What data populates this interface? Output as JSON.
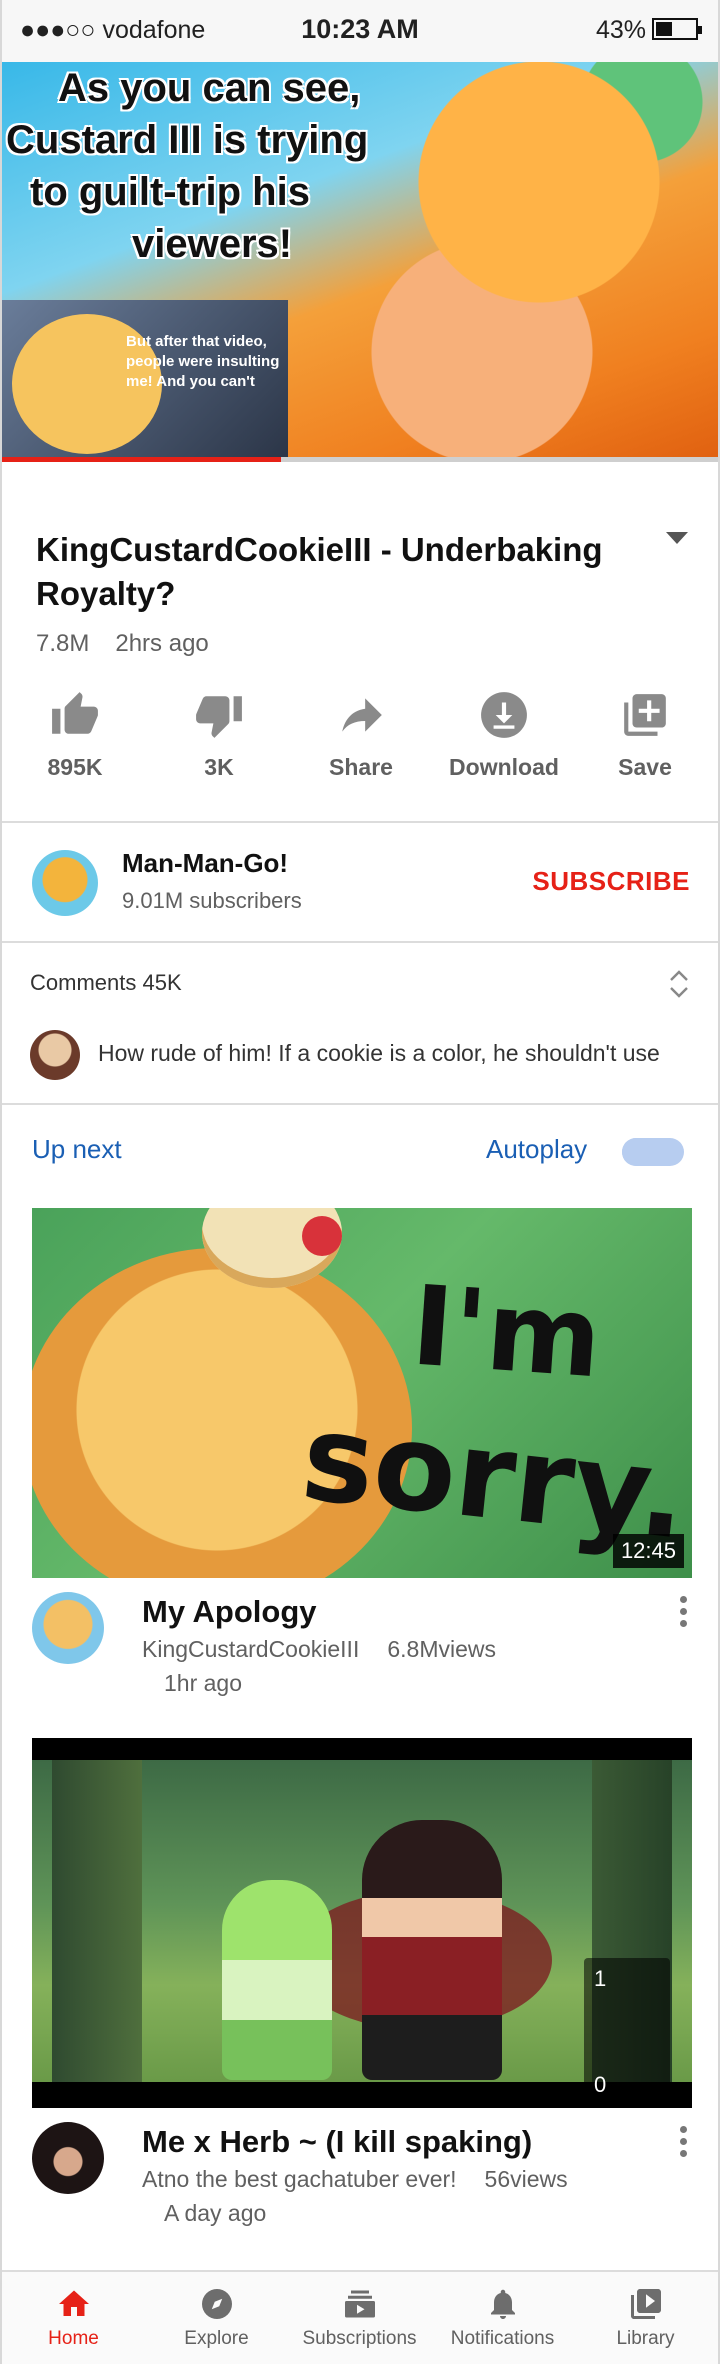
{
  "status_bar": {
    "carrier": "●●●○○ vodafone",
    "time": "10:23 AM",
    "battery": "43%"
  },
  "player": {
    "caption_lines": [
      "As you can see,",
      "Custard III is trying",
      "to guilt-trip his",
      "viewers!"
    ],
    "inset_text": "But after that video, people were insulting me! And you can't",
    "progress_fraction": 0.39,
    "progress_color": "#e62117"
  },
  "video": {
    "title": "KingCustardCookieIII - Underbaking Royalty?",
    "views": "7.8M",
    "age": "2hrs ago"
  },
  "actions": [
    {
      "icon": "thumbs-up-icon",
      "label": "895K"
    },
    {
      "icon": "thumbs-down-icon",
      "label": "3K"
    },
    {
      "icon": "share-icon",
      "label": "Share"
    },
    {
      "icon": "download-icon",
      "label": "Download"
    },
    {
      "icon": "save-icon",
      "label": "Save"
    }
  ],
  "channel": {
    "name": "Man-Man-Go!",
    "subscribers": "9.01M subscribers",
    "subscribe_label": "SUBSCRIBE",
    "subscribe_color": "#e62117"
  },
  "comments": {
    "title": "Comments 45K",
    "top_comment": "How rude of him! If a cookie is a color, he shouldn't use"
  },
  "up_next": {
    "label": "Up next",
    "autoplay_label": "Autoplay",
    "autoplay_on": false,
    "link_color": "#1a5fb4"
  },
  "videos": [
    {
      "thumb_text_1": "I'm",
      "thumb_text_2": "sorry.",
      "duration": "12:45",
      "title": "My Apology",
      "channel": "KingCustardCookieIII",
      "views": "6.8Mviews",
      "age": "1hr ago"
    },
    {
      "overlay_top": "1",
      "overlay_bottom": "0",
      "title": "Me x Herb ~ (I kill spaking)",
      "channel": "Atno the best gachatuber ever!",
      "views": "56views",
      "age": "A day ago"
    }
  ],
  "bottom_nav": [
    {
      "icon": "home-icon",
      "label": "Home",
      "active": true
    },
    {
      "icon": "explore-icon",
      "label": "Explore",
      "active": false
    },
    {
      "icon": "subscriptions-icon",
      "label": "Subscriptions",
      "active": false
    },
    {
      "icon": "notifications-icon",
      "label": "Notifications",
      "active": false
    },
    {
      "icon": "library-icon",
      "label": "Library",
      "active": false
    }
  ]
}
